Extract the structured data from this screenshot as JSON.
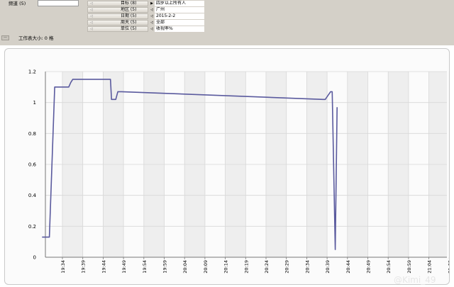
{
  "toolbar": {
    "channel_label": "频道 (5)",
    "channel_value": "",
    "filters": [
      {
        "label": "目标 (8)",
        "value": "四岁以上所有人",
        "expanded": true
      },
      {
        "label": "地区 (5)",
        "value": "广州",
        "expanded": false
      },
      {
        "label": "日期 (5)",
        "value": "2015-2-2",
        "expanded": false
      },
      {
        "label": "周天 (5)",
        "value": "全部",
        "expanded": false
      },
      {
        "label": "单位 (5)",
        "value": "收视率%",
        "expanded": false
      }
    ],
    "worksheet_size_label": "工作表大小: 0 格",
    "arrow_glyph": "◁",
    "expanded_glyph": "▶",
    "collapsed_glyph": "◁",
    "minus_glyph": "—"
  },
  "chart_data": {
    "type": "line",
    "title": "",
    "xlabel": "",
    "ylabel": "",
    "ylim": [
      0,
      1.2
    ],
    "yticks": [
      "0",
      "0.2",
      "0.4",
      "0.6",
      "0.8",
      "1",
      "1.2"
    ],
    "xticks": [
      "19:34",
      "19:39",
      "19:44",
      "19:49",
      "19:54",
      "19:59",
      "20:04",
      "20:09",
      "20:14",
      "20:19",
      "20:24",
      "20:29",
      "20:34",
      "20:39",
      "20:44",
      "20:49",
      "20:54",
      "20:59",
      "21:04",
      "21:09"
    ],
    "grid": true,
    "line_color": "#5a5a9e",
    "series": [
      {
        "x": [
          19.3,
          19.59,
          19.66,
          19.92,
          20.05,
          20.56,
          20.61,
          20.71,
          20.81,
          21.69,
          22.19,
          22.3,
          22.66,
          22.71,
          22.92,
          23.02,
          23.06,
          23.21,
          33.1,
          33.21,
          33.47,
          33.55,
          33.7,
          33.79
        ],
        "values": [
          0.13,
          0.13,
          0.13,
          1.1,
          1.1,
          1.1,
          1.1,
          1.13,
          1.15,
          1.15,
          1.15,
          1.15,
          1.15,
          1.02,
          1.02,
          1.07,
          1.07,
          1.07,
          1.02,
          1.02,
          1.07,
          1.07,
          0.05,
          0.97
        ]
      }
    ]
  },
  "watermark_text": "@Kimi_49"
}
